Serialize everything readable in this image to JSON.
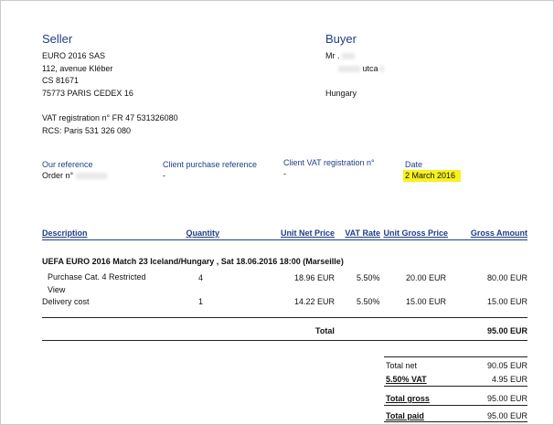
{
  "seller": {
    "heading": "Seller",
    "lines": [
      "EURO 2016 SAS",
      "112, avenue Kléber",
      "CS 81671",
      "75773 PARIS CEDEX 16"
    ],
    "vat": "VAT registration n° FR 47 531326080",
    "rcs": "RCS: Paris 531 326 080"
  },
  "buyer": {
    "heading": "Buyer",
    "name": "Mr .",
    "street": "utca",
    "country": "Hungary"
  },
  "refs": {
    "our_label": "Our reference",
    "our_value": "Order n°",
    "client_po_label": "Client purchase reference",
    "client_po_value": "-",
    "client_vat_label": "Client VAT registration n°",
    "client_vat_value": "-",
    "date_label": "Date",
    "date_value": "2 March 2016"
  },
  "table": {
    "headers": {
      "description": "Description",
      "quantity": "Quantity",
      "unit_net": "Unit Net Price",
      "vat_rate": "VAT Rate",
      "unit_gross": "Unit Gross Price",
      "gross_amount": "Gross Amount"
    },
    "event": "UEFA EURO 2016 Match 23 Iceland/Hungary , Sat 18.06.2016 18:00 (Marseille)",
    "rows": [
      {
        "desc1": "Purchase  Cat. 4 Restricted",
        "desc2": "View",
        "qty": "4",
        "unit_net": "18.96 EUR",
        "vat": "5.50%",
        "unit_gross": "20.00 EUR",
        "gross": "80.00 EUR"
      },
      {
        "desc1": "Delivery cost",
        "desc2": "",
        "qty": "1",
        "unit_net": "14.22 EUR",
        "vat": "5.50%",
        "unit_gross": "15.00 EUR",
        "gross": "15.00 EUR"
      }
    ],
    "total_label": "Total",
    "total_value": "95.00 EUR"
  },
  "summary": {
    "net_label": "Total net",
    "net_value": "90.05 EUR",
    "vat_label": "5.50% VAT",
    "vat_value": "4.95 EUR",
    "gross_label": "Total gross",
    "gross_value": "95.00 EUR",
    "paid_label": "Total paid",
    "paid_value": "95.00 EUR"
  },
  "colors": {
    "heading": "#1f3e86",
    "highlight": "#f7f21e"
  }
}
